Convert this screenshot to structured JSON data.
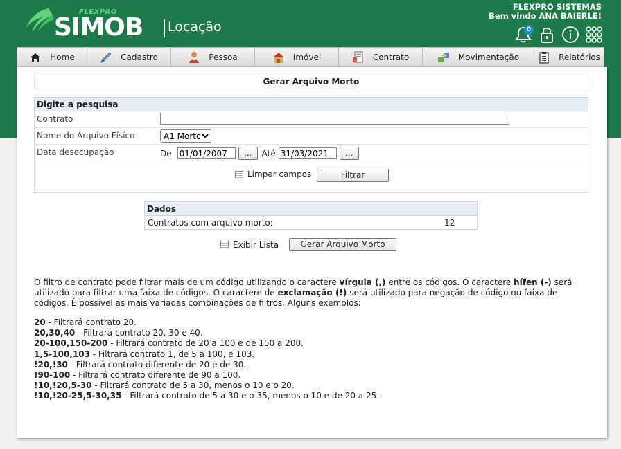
{
  "header": {
    "logo_small": "FLEXPRO",
    "logo_main": "SIMOB",
    "logo_sub": "Locação",
    "company": "FLEXPRO SISTEMAS",
    "welcome": "Bem vindo ANA BAIERLE!",
    "notif_count": "0",
    "icons": [
      "bell-icon",
      "lock-icon",
      "info-icon",
      "apps-grid-icon"
    ]
  },
  "menu": [
    {
      "label": "Home",
      "icon": "home-icon"
    },
    {
      "label": "Cadastro",
      "icon": "pen-icon"
    },
    {
      "label": "Pessoa",
      "icon": "person-icon"
    },
    {
      "label": "Imóvel",
      "icon": "house-icon"
    },
    {
      "label": "Contrato",
      "icon": "contract-icon"
    },
    {
      "label": "Movimentação",
      "icon": "transfer-icon"
    },
    {
      "label": "Relatórios",
      "icon": "clipboard-icon"
    }
  ],
  "page_title": "Gerar Arquivo Morto",
  "search": {
    "heading": "Digite a pesquisa",
    "contrato_label": "Contrato",
    "contrato_value": "",
    "arquivo_label": "Nome do Arquivo Físico",
    "arquivo_value": "A1 Morto",
    "data_label": "Data desocupação",
    "de_label": "De",
    "de_value": "01/01/2007",
    "ate_label": "Até",
    "ate_value": "31/03/2021",
    "picker_label": "...",
    "clear_label": "Limpar campos",
    "filter_label": "Filtrar"
  },
  "dados": {
    "heading": "Dados",
    "row_label": "Contratos com arquivo morto:",
    "row_value": "12"
  },
  "actions": {
    "list_label": "Exibir Lista",
    "generate_label": "Gerar Arquivo Morto"
  },
  "help": {
    "p1": "O filtro de contrato pode filtrar mais de um código utilizando o caractere ",
    "b1": "vírgula (,)",
    "p2": " entre os códigos. O caractere ",
    "b2": "hífen (-)",
    "p3": " será utilizado para filtrar uma faixa de códigos. O caractere de ",
    "b3": "exclamação (!)",
    "p4": " será utilizado para negação de código ou faixa de códigos. É possivel as mais variadas combinações de filtros. Alguns exemplos:"
  },
  "examples": [
    {
      "code": "20",
      "text": " - Filtrará contrato 20."
    },
    {
      "code": "20,30,40",
      "text": " - Filtrará contrato 20, 30 e 40."
    },
    {
      "code": "20-100,150-200",
      "text": " - Filtrará contrato de 20 a 100 e de 150 a 200."
    },
    {
      "code": "1,5-100,103",
      "text": " - Filtrará contrato 1, de 5 a 100, e 103."
    },
    {
      "code": "!20,!30",
      "text": " - Filtrará contrato diferente de 20 e de 30."
    },
    {
      "code": "!90-100",
      "text": " - Filtrará contrato diferente de 90 a 100."
    },
    {
      "code": "!10,!20,5-30",
      "text": " - Filtrará contrato de 5 a 30, menos o 10 e o 20."
    },
    {
      "code": "!10,!20-25,5-30,35",
      "text": " - Filtrará contrato de 5 a 30 e o 35, menos o 10 e de 20 a 25."
    }
  ],
  "colors": {
    "brand_green": "#1f7a4a",
    "logo_accent": "#5fd47a",
    "badge_blue": "#1e90d8",
    "section_header": "#e6edf5"
  }
}
